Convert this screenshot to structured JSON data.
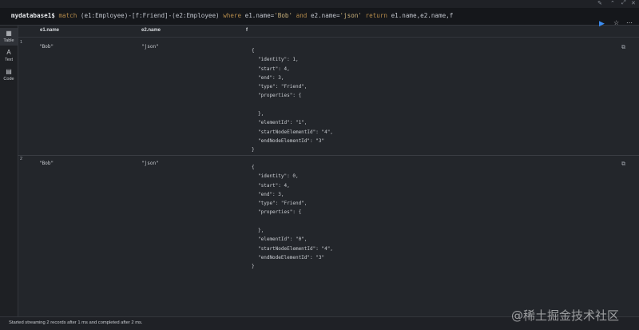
{
  "query": {
    "prompt": "mydatabase1$",
    "kw_match": "match",
    "p1": "(e1:Employee)-[f:Friend]-(e2:Employee)",
    "kw_where": "where",
    "cond1": "e1.name=",
    "val1": "'Bob'",
    "kw_and": "and",
    "cond2": "e2.name=",
    "val2": "'json'",
    "kw_return": "return",
    "ret": "e1.name,e2.name,f"
  },
  "sidebar": {
    "items": [
      {
        "label": "Table",
        "icon": "table-icon"
      },
      {
        "label": "Text",
        "icon": "text-icon"
      },
      {
        "label": "Code",
        "icon": "code-icon"
      }
    ]
  },
  "columns": [
    "e1.name",
    "e2.name",
    "f"
  ],
  "rows": [
    {
      "num": "1",
      "e1": "\"Bob\"",
      "e2": "\"json\"",
      "json_lines": [
        "{",
        "\"identity\": 1,",
        "\"start\": 4,",
        "\"end\": 3,",
        "\"type\": \"Friend\",",
        "\"properties\": {",
        "",
        "},",
        "\"elementId\": \"1\",",
        "\"startNodeElementId\": \"4\",",
        "\"endNodeElementId\": \"3\"",
        "}"
      ]
    },
    {
      "num": "2",
      "e1": "\"Bob\"",
      "e2": "\"json\"",
      "json_lines": [
        "{",
        "\"identity\": 0,",
        "\"start\": 4,",
        "\"end\": 3,",
        "\"type\": \"Friend\",",
        "\"properties\": {",
        "",
        "},",
        "\"elementId\": \"0\",",
        "\"startNodeElementId\": \"4\",",
        "\"endNodeElementId\": \"3\"",
        "}"
      ]
    }
  ],
  "status": "Started streaming 2 records after 1 ms and completed after 2 ms.",
  "watermark": "@稀土掘金技术社区",
  "colors": {
    "accent": "#3b8cf0",
    "background": "#23262b"
  }
}
